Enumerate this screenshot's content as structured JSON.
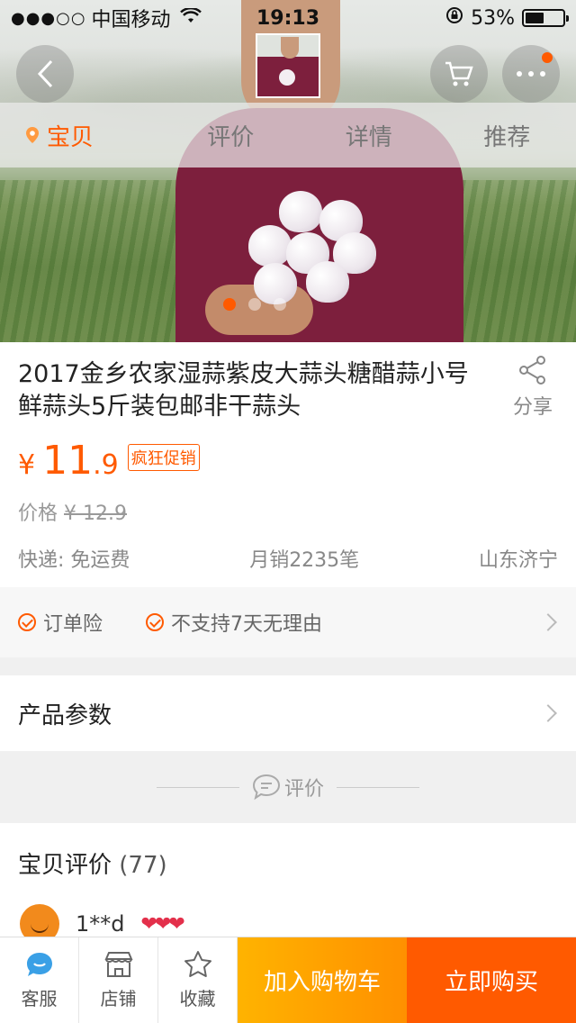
{
  "status_bar": {
    "signal": "●●●○○",
    "carrier": "中国移动",
    "time": "19:13",
    "battery": "53%",
    "battery_level": 0.53
  },
  "nav": {
    "back_icon": "back-arrow-icon",
    "cart_icon": "cart-icon",
    "more_icon": "more-icon",
    "tabs": [
      {
        "label": "宝贝",
        "active": true
      },
      {
        "label": "评价",
        "active": false
      },
      {
        "label": "详情",
        "active": false
      },
      {
        "label": "推荐",
        "active": false
      }
    ]
  },
  "gallery": {
    "page_count": 3,
    "current_page": 1
  },
  "product": {
    "title": "2017金乡农家湿蒜紫皮大蒜头糖醋蒜小号鲜蒜头5斤装包邮非干蒜头",
    "share_label": "分享",
    "currency": "¥",
    "price_int": "11",
    "price_dec": ".9",
    "promo_tag": "疯狂促销",
    "orig_price_label": "价格",
    "orig_price": "¥ 12.9",
    "shipping": "快递: 免运费",
    "monthly_sales": "月销2235笔",
    "location": "山东济宁"
  },
  "services": [
    {
      "label": "订单险"
    },
    {
      "label": "不支持7天无理由"
    }
  ],
  "params_label": "产品参数",
  "review_divider": "评价",
  "reviews": {
    "title": "宝贝评价",
    "count": "(77)",
    "first_user": "1**d",
    "first_user_level": "❤❤❤"
  },
  "bottom_bar": {
    "service_label": "客服",
    "shop_label": "店铺",
    "fav_label": "收藏",
    "add_cart_label": "加入购物车",
    "buy_now_label": "立即购买"
  },
  "colors": {
    "accent": "#ff5a00",
    "cart": "#ff9000",
    "text": "#333333"
  }
}
